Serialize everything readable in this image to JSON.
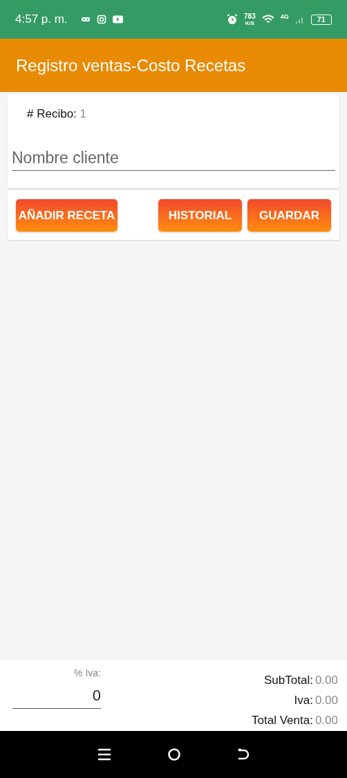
{
  "status_bar": {
    "time": "4:57 p. m.",
    "speed": "783",
    "speed_unit": "K/S",
    "network": "4G",
    "battery": "71"
  },
  "app_bar": {
    "title": "Registro ventas-Costo Recetas"
  },
  "receipt": {
    "label": "# Recibo:",
    "value": "1"
  },
  "client_field": {
    "placeholder": "Nombre cliente"
  },
  "buttons": [
    {
      "label": "AÑADIR RECETA"
    },
    {
      "label": "HISTORIAL"
    },
    {
      "label": "GUARDAR"
    }
  ],
  "iva_field": {
    "label": "% Iva:",
    "value": "0"
  },
  "totals": [
    {
      "label": "SubTotal:",
      "value": "0.00"
    },
    {
      "label": "Iva:",
      "value": "0.00"
    },
    {
      "label": "Total Venta:",
      "value": "0.00"
    }
  ]
}
